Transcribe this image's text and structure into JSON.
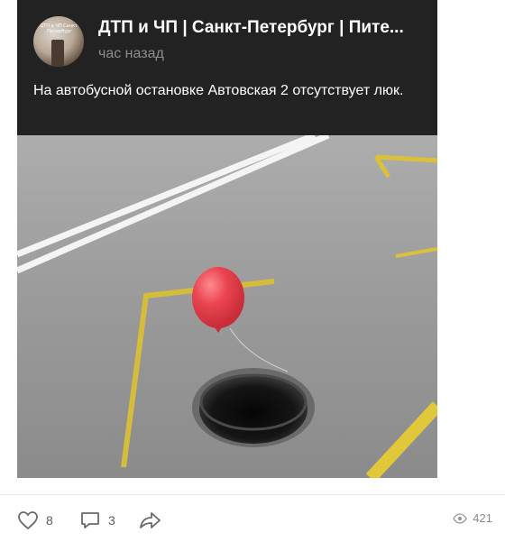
{
  "post": {
    "channel_name": "ДТП и ЧП | Санкт-Петербург | Пите...",
    "time": "час назад",
    "text": "На автобусной остановке Автовская 2 отсутствует люк.",
    "avatar_text": "ДТП и ЧП Санкт-Петербург",
    "photo_icon": "road-open-manhole-balloon"
  },
  "footer": {
    "likes": "8",
    "comments": "3",
    "views": "421",
    "icons": {
      "like": "heart-icon",
      "comment": "comment-icon",
      "share": "share-icon",
      "views": "eye-icon"
    }
  },
  "colors": {
    "header_bg": "#222222",
    "balloon": "#e8434e",
    "road_marking_yellow": "#d9c23a",
    "road_marking_white": "#ffffff"
  }
}
